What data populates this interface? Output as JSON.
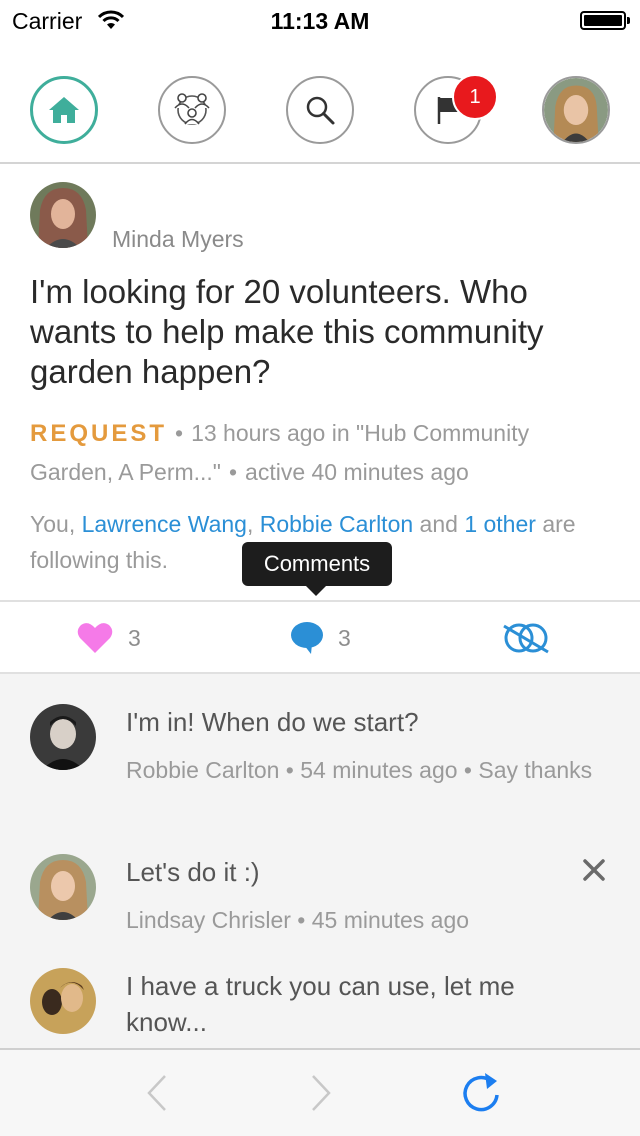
{
  "status_bar": {
    "carrier": "Carrier",
    "time": "11:13 AM"
  },
  "nav": {
    "notification_count": "1",
    "accent_color": "#3fae9b",
    "items": [
      "home-icon",
      "groups-icon",
      "search-icon",
      "flag-icon",
      "avatar"
    ]
  },
  "post": {
    "author": "Minda Myers",
    "title": "I'm looking for 20 volunteers. Who wants to help make this community garden happen?",
    "type_label": "REQUEST",
    "time": "13 hours ago in \"Hub Community Garden, A Perm...\"",
    "activity": "active 40 minutes ago",
    "following": {
      "prefix": "You,",
      "person1": "Lawrence Wang",
      "person2": "Robbie Carlton",
      "and_text": "and",
      "others": "1 other",
      "suffix": "are following this."
    }
  },
  "tooltip": "Comments",
  "actions": {
    "likes": "3",
    "comments": "3"
  },
  "comments": [
    {
      "text": "I'm in! When do we start?",
      "author": "Robbie Carlton",
      "time": "54 minutes ago",
      "action": "Say thanks"
    },
    {
      "text": "Let's do it :)",
      "author": "Lindsay Chrisler",
      "time": "45 minutes ago"
    },
    {
      "text": "I have a truck you can use, let me know..."
    }
  ]
}
